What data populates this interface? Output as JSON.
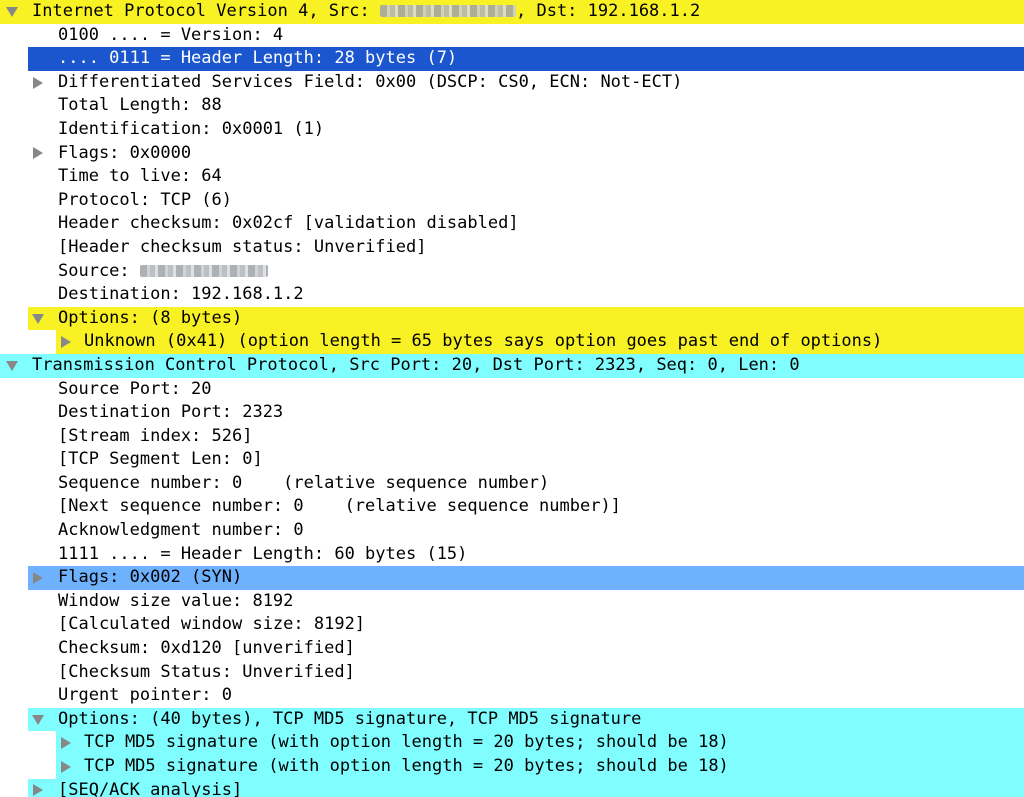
{
  "colors": {
    "ip_header": "#f8f224",
    "ip_options": "#f8f224",
    "tcp": "#7ffdff",
    "selected": "#1b56cf",
    "tcp_flags": "#6eb1fd"
  },
  "rows": [
    {
      "text": "Internet Protocol Version 4, Src: ",
      "tail": ", Dst: 192.168.1.2",
      "redacted": "source-ip",
      "level": 0,
      "toggle": "expanded",
      "bg": "ip_header",
      "name": "ip-header-row"
    },
    {
      "text": "0100 .... = Version: 4",
      "level": 1,
      "toggle": "none",
      "bg": "",
      "name": "ip-version-row"
    },
    {
      "text": ".... 0111 = Header Length: 28 bytes (7)",
      "level": 1,
      "toggle": "none",
      "bg": "selected",
      "selected": true,
      "name": "ip-header-length-row"
    },
    {
      "text": "Differentiated Services Field: 0x00 (DSCP: CS0, ECN: Not-ECT)",
      "level": 1,
      "toggle": "collapsed",
      "bg": "",
      "name": "ip-dsfield-row"
    },
    {
      "text": "Total Length: 88",
      "level": 1,
      "toggle": "none",
      "bg": "",
      "name": "ip-total-length-row"
    },
    {
      "text": "Identification: 0x0001 (1)",
      "level": 1,
      "toggle": "none",
      "bg": "",
      "name": "ip-identification-row"
    },
    {
      "text": "Flags: 0x0000",
      "level": 1,
      "toggle": "collapsed",
      "bg": "",
      "name": "ip-flags-row"
    },
    {
      "text": "Time to live: 64",
      "level": 1,
      "toggle": "none",
      "bg": "",
      "name": "ip-ttl-row"
    },
    {
      "text": "Protocol: TCP (6)",
      "level": 1,
      "toggle": "none",
      "bg": "",
      "name": "ip-protocol-row"
    },
    {
      "text": "Header checksum: 0x02cf [validation disabled]",
      "level": 1,
      "toggle": "none",
      "bg": "",
      "name": "ip-checksum-row"
    },
    {
      "text": "[Header checksum status: Unverified]",
      "level": 1,
      "toggle": "none",
      "bg": "",
      "name": "ip-checksum-status-row"
    },
    {
      "text": "Source: ",
      "tail": "",
      "redacted": "source-ip",
      "level": 1,
      "toggle": "none",
      "bg": "",
      "name": "ip-source-row"
    },
    {
      "text": "Destination: 192.168.1.2",
      "level": 1,
      "toggle": "none",
      "bg": "",
      "name": "ip-destination-row"
    },
    {
      "text": "Options: (8 bytes)",
      "level": 1,
      "toggle": "expanded",
      "bg": "ip_options",
      "name": "ip-options-row"
    },
    {
      "text": "Unknown (0x41) (option length = 65 bytes says option goes past end of options)",
      "level": 2,
      "toggle": "collapsed",
      "bg": "ip_options",
      "name": "ip-option-unknown-row"
    },
    {
      "text": "Transmission Control Protocol, Src Port: 20, Dst Port: 2323, Seq: 0, Len: 0",
      "level": 0,
      "toggle": "expanded",
      "bg": "tcp",
      "name": "tcp-header-row"
    },
    {
      "text": "Source Port: 20",
      "level": 1,
      "toggle": "none",
      "bg": "",
      "name": "tcp-srcport-row"
    },
    {
      "text": "Destination Port: 2323",
      "level": 1,
      "toggle": "none",
      "bg": "",
      "name": "tcp-dstport-row"
    },
    {
      "text": "[Stream index: 526]",
      "level": 1,
      "toggle": "none",
      "bg": "",
      "name": "tcp-stream-row"
    },
    {
      "text": "[TCP Segment Len: 0]",
      "level": 1,
      "toggle": "none",
      "bg": "",
      "name": "tcp-seglen-row"
    },
    {
      "text": "Sequence number: 0    (relative sequence number)",
      "level": 1,
      "toggle": "none",
      "bg": "",
      "name": "tcp-seq-row"
    },
    {
      "text": "[Next sequence number: 0    (relative sequence number)]",
      "level": 1,
      "toggle": "none",
      "bg": "",
      "name": "tcp-nextseq-row"
    },
    {
      "text": "Acknowledgment number: 0",
      "level": 1,
      "toggle": "none",
      "bg": "",
      "name": "tcp-ack-row"
    },
    {
      "text": "1111 .... = Header Length: 60 bytes (15)",
      "level": 1,
      "toggle": "none",
      "bg": "",
      "name": "tcp-header-length-row"
    },
    {
      "text": "Flags: 0x002 (SYN)",
      "level": 1,
      "toggle": "collapsed",
      "bg": "tcp_flags",
      "name": "tcp-flags-row"
    },
    {
      "text": "Window size value: 8192",
      "level": 1,
      "toggle": "none",
      "bg": "",
      "name": "tcp-window-row"
    },
    {
      "text": "[Calculated window size: 8192]",
      "level": 1,
      "toggle": "none",
      "bg": "",
      "name": "tcp-calc-window-row"
    },
    {
      "text": "Checksum: 0xd120 [unverified]",
      "level": 1,
      "toggle": "none",
      "bg": "",
      "name": "tcp-checksum-row"
    },
    {
      "text": "[Checksum Status: Unverified]",
      "level": 1,
      "toggle": "none",
      "bg": "",
      "name": "tcp-checksum-status-row"
    },
    {
      "text": "Urgent pointer: 0",
      "level": 1,
      "toggle": "none",
      "bg": "",
      "name": "tcp-urgent-row"
    },
    {
      "text": "Options: (40 bytes), TCP MD5 signature, TCP MD5 signature",
      "level": 1,
      "toggle": "expanded",
      "bg": "tcp",
      "name": "tcp-options-row"
    },
    {
      "text": "TCP MD5 signature (with option length = 20 bytes; should be 18)",
      "level": 2,
      "toggle": "collapsed",
      "bg": "tcp",
      "name": "tcp-md5-option-row"
    },
    {
      "text": "TCP MD5 signature (with option length = 20 bytes; should be 18)",
      "level": 2,
      "toggle": "collapsed",
      "bg": "tcp",
      "name": "tcp-md5-option-row"
    },
    {
      "text": "[SEQ/ACK analysis]",
      "level": 1,
      "toggle": "collapsed",
      "bg": "tcp",
      "name": "tcp-seqack-row"
    }
  ]
}
